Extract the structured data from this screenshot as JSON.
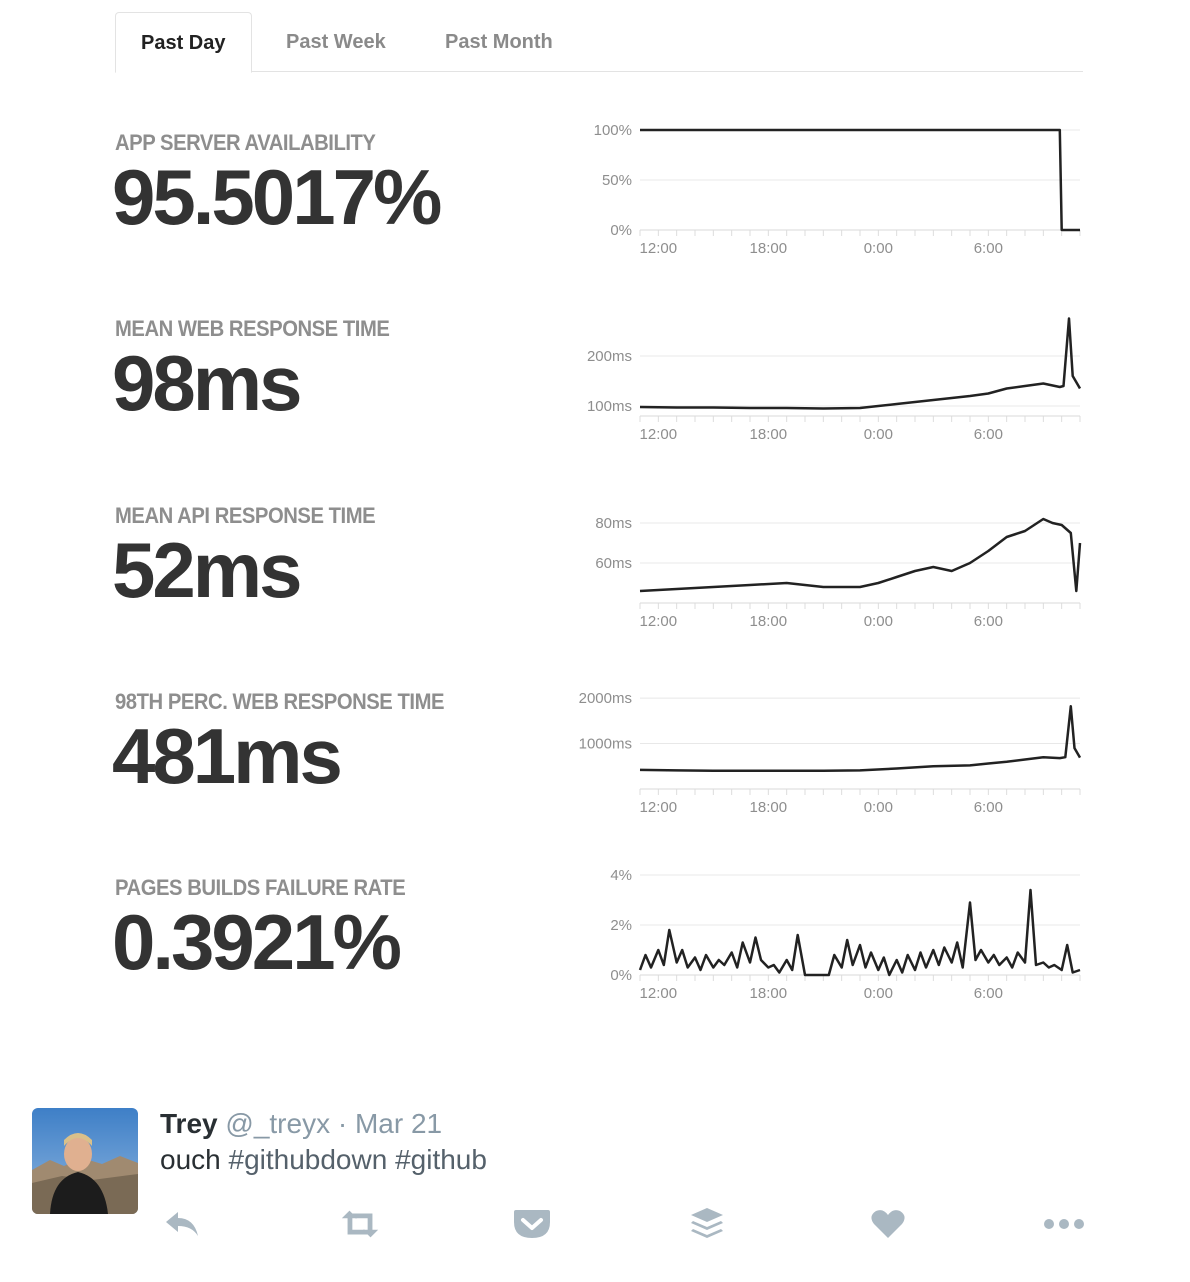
{
  "tabs": [
    {
      "label": "Past Day",
      "active": true
    },
    {
      "label": "Past Week",
      "active": false
    },
    {
      "label": "Past Month",
      "active": false
    }
  ],
  "metrics": [
    {
      "label": "APP SERVER AVAILABILITY",
      "value": "95.5017%",
      "chart_data": {
        "type": "line",
        "x_ticks": [
          "12:00",
          "18:00",
          "0:00",
          "6:00"
        ],
        "y_ticks": [
          "100%",
          "50%",
          "0%"
        ],
        "ylim": [
          0,
          100
        ],
        "x_range": [
          0,
          24
        ],
        "grid": true,
        "series": [
          {
            "x": [
              0,
              22.9,
              23.0,
              24
            ],
            "values": [
              100,
              100,
              0,
              0
            ]
          }
        ]
      }
    },
    {
      "label": "MEAN WEB RESPONSE TIME",
      "value": "98ms",
      "chart_data": {
        "type": "line",
        "x_ticks": [
          "12:00",
          "18:00",
          "0:00",
          "6:00"
        ],
        "y_ticks": [
          "200ms",
          "100ms"
        ],
        "ylim": [
          80,
          280
        ],
        "x_range": [
          0,
          24
        ],
        "grid": true,
        "series": [
          {
            "x": [
              0,
              2,
              4,
              6,
              8,
              10,
              12,
              13,
              14,
              15,
              16,
              17,
              18,
              19,
              20,
              21,
              22,
              22.9,
              23.1,
              23.4,
              23.6,
              24
            ],
            "values": [
              98,
              97,
              97,
              96,
              96,
              95,
              96,
              100,
              104,
              108,
              112,
              116,
              120,
              125,
              135,
              140,
              145,
              138,
              140,
              275,
              160,
              135
            ]
          }
        ]
      }
    },
    {
      "label": "MEAN API RESPONSE TIME",
      "value": "52ms",
      "chart_data": {
        "type": "line",
        "x_ticks": [
          "12:00",
          "18:00",
          "0:00",
          "6:00"
        ],
        "y_ticks": [
          "80ms",
          "60ms"
        ],
        "ylim": [
          40,
          90
        ],
        "x_range": [
          0,
          24
        ],
        "grid": true,
        "series": [
          {
            "x": [
              0,
              2,
              4,
              6,
              8,
              10,
              12,
              13,
              14,
              15,
              16,
              17,
              18,
              19,
              20,
              21,
              22,
              22.5,
              23,
              23.5,
              23.8,
              24
            ],
            "values": [
              46,
              47,
              48,
              49,
              50,
              48,
              48,
              50,
              53,
              56,
              58,
              56,
              60,
              66,
              73,
              76,
              82,
              80,
              79,
              75,
              46,
              70
            ]
          }
        ]
      }
    },
    {
      "label": "98TH PERC. WEB RESPONSE TIME",
      "value": "481ms",
      "chart_data": {
        "type": "line",
        "x_ticks": [
          "12:00",
          "18:00",
          "0:00",
          "6:00"
        ],
        "y_ticks": [
          "2000ms",
          "1000ms"
        ],
        "ylim": [
          0,
          2200
        ],
        "x_range": [
          0,
          24
        ],
        "grid": true,
        "series": [
          {
            "x": [
              0,
              2,
              4,
              6,
              8,
              10,
              12,
              14,
              16,
              18,
              19,
              20,
              21,
              22,
              22.9,
              23.2,
              23.5,
              23.7,
              24
            ],
            "values": [
              420,
              410,
              400,
              400,
              400,
              400,
              410,
              450,
              500,
              520,
              560,
              600,
              650,
              700,
              680,
              700,
              1820,
              900,
              690
            ]
          }
        ]
      }
    },
    {
      "label": "PAGES BUILDS FAILURE RATE",
      "value": "0.3921%",
      "chart_data": {
        "type": "line",
        "x_ticks": [
          "12:00",
          "18:00",
          "0:00",
          "6:00"
        ],
        "y_ticks": [
          "4%",
          "2%",
          "0%"
        ],
        "ylim": [
          0,
          4
        ],
        "x_range": [
          0,
          24
        ],
        "grid": true,
        "series": [
          {
            "x": [
              0,
              0.3,
              0.6,
              1,
              1.3,
              1.6,
              2,
              2.3,
              2.6,
              3,
              3.3,
              3.6,
              4,
              4.3,
              4.6,
              5,
              5.3,
              5.6,
              6,
              6.3,
              6.6,
              7,
              7.3,
              7.6,
              8,
              8.3,
              8.6,
              9,
              9.3,
              9.6,
              10,
              10.3,
              10.6,
              11,
              11.3,
              11.6,
              12,
              12.3,
              12.6,
              13,
              13.3,
              13.6,
              14,
              14.3,
              14.6,
              15,
              15.3,
              15.6,
              16,
              16.3,
              16.6,
              17,
              17.3,
              17.6,
              18,
              18.3,
              18.6,
              19,
              19.3,
              19.6,
              20,
              20.3,
              20.6,
              21,
              21.3,
              21.6,
              22,
              22.3,
              22.6,
              23,
              23.3,
              23.6,
              24
            ],
            "values": [
              0.2,
              0.8,
              0.3,
              1.0,
              0.4,
              1.8,
              0.5,
              1.0,
              0.3,
              0.7,
              0.2,
              0.8,
              0.3,
              0.6,
              0.4,
              0.9,
              0.3,
              1.3,
              0.5,
              1.5,
              0.6,
              0.3,
              0.4,
              0.1,
              0.6,
              0.2,
              1.6,
              0.0,
              0.0,
              0.0,
              0.0,
              0.0,
              0.8,
              0.3,
              1.4,
              0.4,
              1.2,
              0.3,
              0.9,
              0.2,
              0.7,
              0.0,
              0.6,
              0.1,
              0.8,
              0.2,
              0.9,
              0.3,
              1.0,
              0.4,
              1.1,
              0.5,
              1.3,
              0.3,
              2.9,
              0.6,
              1.0,
              0.5,
              0.8,
              0.4,
              0.7,
              0.3,
              0.9,
              0.5,
              3.4,
              0.4,
              0.5,
              0.3,
              0.4,
              0.2,
              1.2,
              0.1,
              0.2
            ]
          }
        ]
      }
    }
  ],
  "tweet": {
    "name": "Trey",
    "handle": "@_treyx",
    "separator": " · ",
    "date": "Mar 21",
    "text_prefix": "ouch ",
    "hashtag1": "#githubdown",
    "space": " ",
    "hashtag2": "#github",
    "actions": [
      "reply-icon",
      "retweet-icon",
      "pocket-icon",
      "buffer-icon",
      "heart-icon",
      "more-icon"
    ],
    "icon_color": "#aab8c2"
  }
}
